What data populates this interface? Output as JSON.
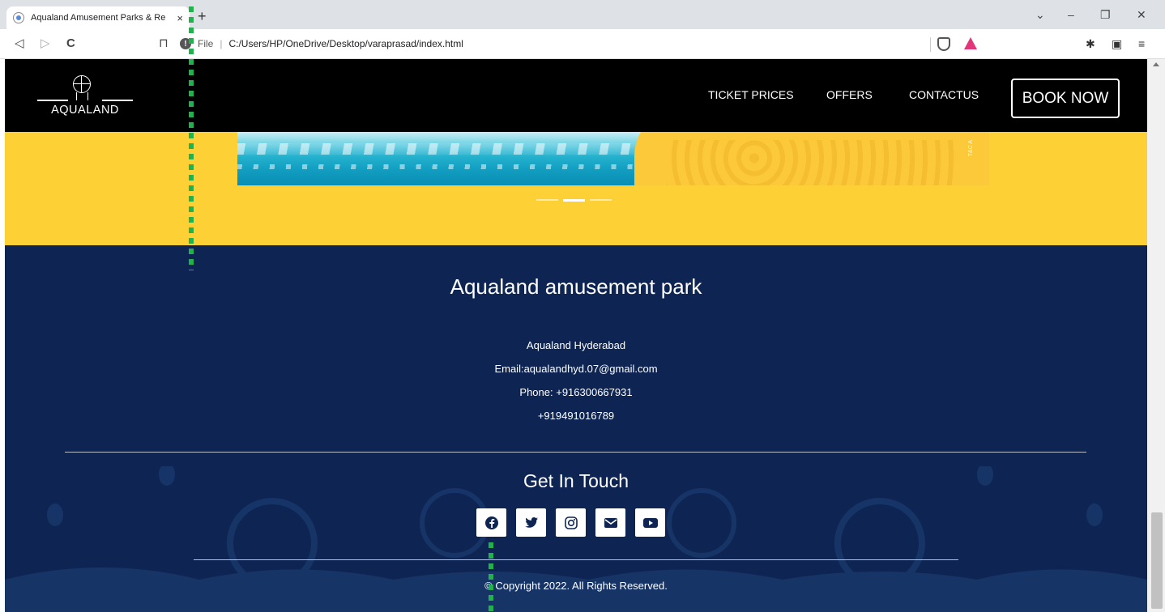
{
  "browser": {
    "tab_title": "Aqualand Amusement Parks & Re",
    "tab_close": "×",
    "new_tab": "+",
    "file_label": "File",
    "url": "C:/Users/HP/OneDrive/Desktop/varaprasad/index.html",
    "back": "◁",
    "forward": "▷",
    "reload": "C",
    "bookmark": "⊓",
    "window_chevron": "⌄",
    "window_min": "–",
    "window_max": "❐",
    "window_close": "✕",
    "extensions": "✱",
    "wallet": "▣",
    "menu": "≡"
  },
  "header": {
    "logo_text": "AQUALAND",
    "nav": [
      "TICKET PRICES",
      "OFFERS",
      "CONTACTUS"
    ],
    "book_label": "BOOK NOW"
  },
  "carousel": {
    "slide_count": 3,
    "active_index": 1,
    "tc_text": "T&C A"
  },
  "footer": {
    "title": "Aqualand amusement park",
    "location": "Aqualand Hyderabad",
    "email": "Email:aqualandhyd.07@gmail.com",
    "phone": "Phone: +916300667931",
    "phone2": "+919491016789",
    "get_in_touch": "Get In Touch",
    "social_icons": [
      "facebook-icon",
      "twitter-icon",
      "instagram-icon",
      "email-icon",
      "youtube-icon"
    ],
    "copyright": "© Copyright 2022. All Rights Reserved."
  },
  "colors": {
    "header_bg": "#000000",
    "band_yellow": "#fdd135",
    "footer_navy": "#0e2553"
  }
}
